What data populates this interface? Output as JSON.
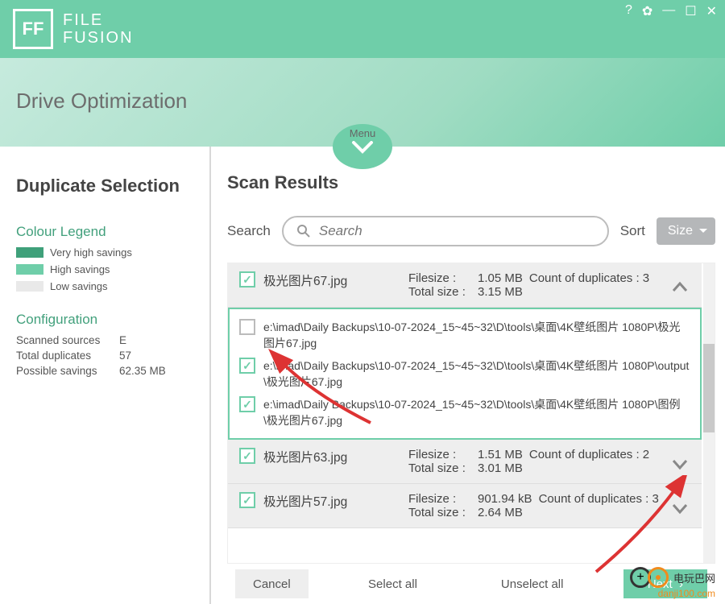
{
  "app": {
    "logo_initials": "FF",
    "name_line1": "FILE",
    "name_line2": "FUSION"
  },
  "header": {
    "title": "Drive Optimization",
    "menu_label": "Menu"
  },
  "sidebar": {
    "title": "Duplicate Selection",
    "legend_title": "Colour Legend",
    "legend": [
      {
        "label": "Very high savings",
        "color": "#3fa07a"
      },
      {
        "label": "High savings",
        "color": "#6fcea9"
      },
      {
        "label": "Low savings",
        "color": "#e9e9e9"
      }
    ],
    "config_title": "Configuration",
    "config": [
      {
        "label": "Scanned sources",
        "value": "E"
      },
      {
        "label": "Total duplicates",
        "value": "57"
      },
      {
        "label": "Possible savings",
        "value": "62.35 MB"
      }
    ]
  },
  "content": {
    "title": "Scan Results",
    "search_label": "Search",
    "search_placeholder": "Search",
    "sort_label": "Sort",
    "sort_value": "Size",
    "filesize_label": "Filesize :",
    "totalsize_label": "Total size :",
    "count_label": "Count of duplicates :",
    "groups": [
      {
        "name": "极光图片67.jpg",
        "filesize": "1.05 MB",
        "count": "3",
        "total": "3.15 MB",
        "expanded": true,
        "files": [
          {
            "checked": false,
            "path": "e:\\imad\\Daily Backups\\10-07-2024_15~45~32\\D\\tools\\桌面\\4K壁纸图片 1080P\\极光图片67.jpg"
          },
          {
            "checked": true,
            "path": "e:\\imad\\Daily Backups\\10-07-2024_15~45~32\\D\\tools\\桌面\\4K壁纸图片 1080P\\output\\极光图片67.jpg"
          },
          {
            "checked": true,
            "path": "e:\\imad\\Daily Backups\\10-07-2024_15~45~32\\D\\tools\\桌面\\4K壁纸图片 1080P\\图例\\极光图片67.jpg"
          }
        ]
      },
      {
        "name": "极光图片63.jpg",
        "filesize": "1.51 MB",
        "count": "2",
        "total": "3.01 MB",
        "expanded": false
      },
      {
        "name": "极光图片57.jpg",
        "filesize": "901.94 kB",
        "count": "3",
        "total": "2.64 MB",
        "expanded": false
      }
    ],
    "footer": {
      "cancel": "Cancel",
      "select_all": "Select all",
      "unselect_all": "Unselect all",
      "next": "Next"
    }
  },
  "watermark": {
    "text": "电玩巴网",
    "url": "danji100.com"
  }
}
